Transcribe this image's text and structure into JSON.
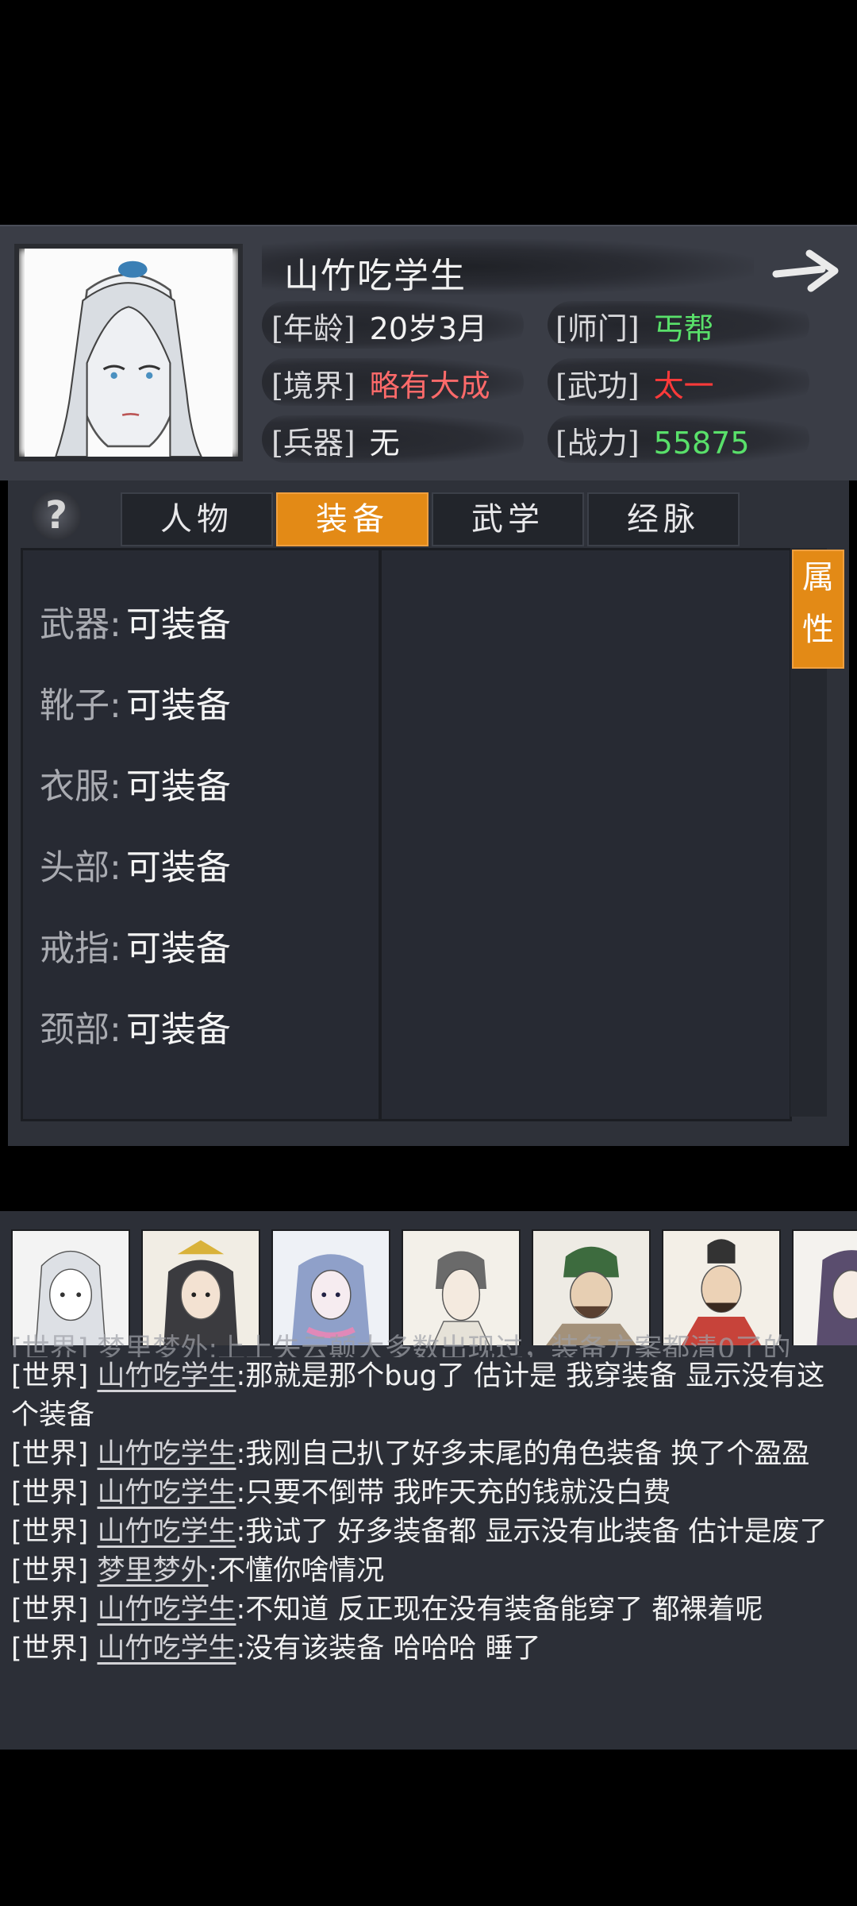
{
  "character": {
    "name": "山竹吃学生",
    "stats": {
      "age_label": "[年龄]",
      "age_value": "20岁3月",
      "sect_label": "[师门]",
      "sect_value": "丐帮",
      "realm_label": "[境界]",
      "realm_value": "略有大成",
      "skill_label": "[武功]",
      "skill_value": "太一",
      "weapon_label": "[兵器]",
      "weapon_value": "无",
      "power_label": "[战力]",
      "power_value": "55875"
    }
  },
  "tabs": [
    {
      "label": "人物",
      "active": false
    },
    {
      "label": "装备",
      "active": true
    },
    {
      "label": "武学",
      "active": false
    },
    {
      "label": "经脉",
      "active": false
    }
  ],
  "help_icon": "?",
  "attr_tab": {
    "line1": "属",
    "line2": "性"
  },
  "equipment": [
    {
      "slot": "武器:",
      "state": "可装备"
    },
    {
      "slot": "靴子:",
      "state": "可装备"
    },
    {
      "slot": "衣服:",
      "state": "可装备"
    },
    {
      "slot": "头部:",
      "state": "可装备"
    },
    {
      "slot": "戒指:",
      "state": "可装备"
    },
    {
      "slot": "颈部:",
      "state": "可装备"
    }
  ],
  "chat": {
    "truncated_top": "[世界] 梦里梦外:上上失云颠大多数出现过，装备方案都清0了的",
    "messages": [
      {
        "tag": "[世界]",
        "user": "山竹吃学生",
        "text": ":那就是那个bug了 估计是 我穿装备 显示没有这个装备"
      },
      {
        "tag": "[世界]",
        "user": "山竹吃学生",
        "text": ":我刚自己扒了好多末尾的角色装备 换了个盈盈"
      },
      {
        "tag": "[世界]",
        "user": "山竹吃学生",
        "text": ":只要不倒带 我昨天充的钱就没白费"
      },
      {
        "tag": "[世界]",
        "user": "山竹吃学生",
        "text": ":我试了 好多装备都 显示没有此装备 估计是废了"
      },
      {
        "tag": "[世界]",
        "user": "梦里梦外",
        "text": ":不懂你啥情况"
      },
      {
        "tag": "[世界]",
        "user": "山竹吃学生",
        "text": ":不知道 反正现在没有装备能穿了 都裸着呢"
      },
      {
        "tag": "[世界]",
        "user": "山竹吃学生",
        "text": ":没有该装备 哈哈哈 睡了"
      }
    ]
  },
  "icons": {
    "arrow": "arrow-right-icon",
    "help": "question-icon"
  }
}
